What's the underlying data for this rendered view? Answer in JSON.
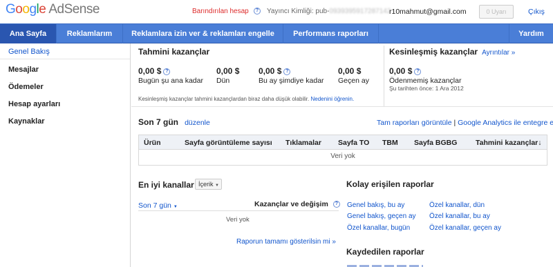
{
  "brand": {
    "google": [
      "G",
      "o",
      "o",
      "g",
      "l",
      "e"
    ],
    "product": "AdSense"
  },
  "header": {
    "hosted_account": "Barındırılan hesap",
    "publisher_id_label": "Yayıncı Kimliği: pub-",
    "publisher_id_value": "0939395917287142",
    "email": "r10mahmut@gmail.com",
    "alerts_button": "0 Uyarı",
    "logout": "Çıkış"
  },
  "nav": {
    "tabs": [
      "Ana Sayfa",
      "Reklamlarım",
      "Reklamlara izin ver & reklamları engelle",
      "Performans raporları"
    ],
    "help": "Yardım"
  },
  "sidebar": {
    "items": [
      "Genel Bakış",
      "Mesajlar",
      "Ödemeler",
      "Hesap ayarları",
      "Kaynaklar"
    ]
  },
  "estimated": {
    "title": "Tahmini kazançlar",
    "cols": [
      {
        "value": "0,00 $",
        "label": "Bugün şu ana kadar",
        "help": true
      },
      {
        "value": "0,00 $",
        "label": "Dün",
        "help": false
      },
      {
        "value": "0,00 $",
        "label": "Bu ay şimdiye kadar",
        "help": true
      },
      {
        "value": "0,00 $",
        "label": "Geçen ay",
        "help": false
      }
    ],
    "note": "Kesinleşmiş kazançlar tahmini kazançlardan biraz daha düşük olabilir.",
    "note_link": "Nedenini öğrenin."
  },
  "finalized": {
    "title": "Kesinleşmiş kazançlar",
    "details_link": "Ayrıntılar »",
    "value": "0,00 $",
    "label": "Ödenmemiş kazançlar",
    "since": "Şu tarihten önce: 1 Ara 2012"
  },
  "last7": {
    "title": "Son 7 gün",
    "edit_link": "düzenle",
    "full_report_link": "Tam raporları görüntüle",
    "separator": "|",
    "analytics_link": "Google Analytics ile entegre et",
    "columns": [
      "Ürün",
      "Sayfa görüntüleme sayısı",
      "Tıklamalar",
      "Sayfa TO",
      "TBM",
      "Sayfa BGBG",
      "Tahmini kazançlar"
    ],
    "sort_arrow": "↓",
    "empty": "Veri yok"
  },
  "best_channels": {
    "title": "En iyi kanallar",
    "dropdown": "İçerik",
    "period": "Son 7 gün",
    "metric": "Kazançlar ve değişim",
    "empty": "Veri yok",
    "full_report": "Raporun tamamı gösterilsin mi »"
  },
  "quick_reports": {
    "title": "Kolay erişilen raporlar",
    "links": [
      [
        "Genel bakış, bu ay",
        "Özel kanallar, dün"
      ],
      [
        "Genel bakış, geçen ay",
        "Özel kanallar, bu ay"
      ],
      [
        "Özel kanallar, bugün",
        "Özel kanallar, geçen ay"
      ]
    ]
  },
  "saved_reports": {
    "title": "Kaydedilen raporlar"
  }
}
